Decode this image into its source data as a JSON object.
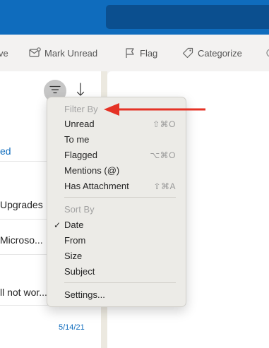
{
  "toolbar": {
    "archive_partial": "ve",
    "mark_unread": "Mark Unread",
    "flag": "Flag",
    "categorize": "Categorize"
  },
  "message_list": {
    "tab_partial": "ed",
    "rows": [
      {
        "subject_partial": "Upgrades"
      },
      {
        "subject_partial": "Microso..."
      },
      {
        "subject_partial": "ll not wor..."
      }
    ],
    "date": "5/14/21"
  },
  "menu": {
    "filter_header": "Filter By",
    "filter_items": [
      {
        "label": "Unread",
        "shortcut": "⇧⌘O"
      },
      {
        "label": "To me",
        "shortcut": ""
      },
      {
        "label": "Flagged",
        "shortcut": "⌥⌘O"
      },
      {
        "label": "Mentions (@)",
        "shortcut": ""
      },
      {
        "label": "Has Attachment",
        "shortcut": "⇧⌘A"
      }
    ],
    "sort_header": "Sort By",
    "sort_items": [
      {
        "label": "Date",
        "checked": true
      },
      {
        "label": "From",
        "checked": false
      },
      {
        "label": "Size",
        "checked": false
      },
      {
        "label": "Subject",
        "checked": false
      }
    ],
    "checkmark": "✓",
    "settings": "Settings..."
  },
  "colors": {
    "accent": "#0f6cbd",
    "annotation_arrow": "#e53225"
  },
  "icons": {
    "filter": "filter-icon",
    "sort": "sort-arrow-icon",
    "mark_unread": "envelope-icon",
    "flag": "flag-icon",
    "categorize": "tag-icon"
  }
}
